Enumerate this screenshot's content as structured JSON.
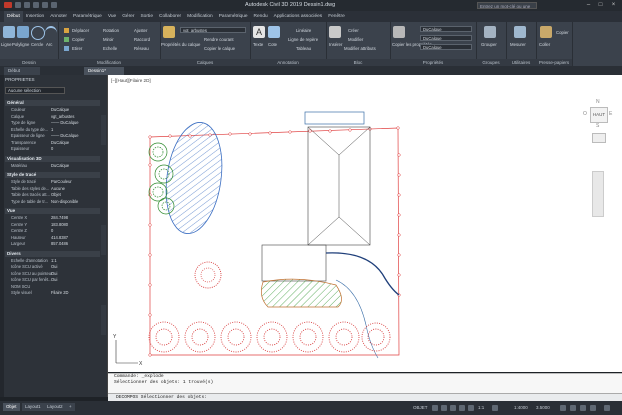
{
  "window": {
    "title": "Autodesk Civil 3D 2019   Dessin1.dwg",
    "search_placeholder": "Entrez un mot-clé ou une expression",
    "user": "Se connecter"
  },
  "menu_tabs": [
    "Début",
    "Insertion",
    "Annoter",
    "Paramétrique",
    "Vue",
    "Gérer",
    "Sortie",
    "Collaborer",
    "Modification",
    "Paramétrique",
    "Rendu",
    "Applications associées",
    "Fenêtre"
  ],
  "active_tab": 0,
  "ribbon": {
    "dessin": {
      "label": "Dessin",
      "items": [
        "Ligne",
        "Polyligne",
        "Cercle",
        "Arc"
      ]
    },
    "modification": {
      "label": "Modification",
      "items": [
        "Déplacer",
        "Rotation",
        "Ajuster",
        "Copier",
        "Miroir",
        "Raccord",
        "Etirer",
        "Echelle",
        "Réseau"
      ]
    },
    "calques": {
      "label": "Calques",
      "items": [
        "Propriétés du calque",
        "Rendre courant",
        "Copier le calque"
      ],
      "layer_value": "vgt_arbustes"
    },
    "annotation": {
      "label": "Annotation",
      "items": [
        "Texte",
        "Cote",
        "Linéaire",
        "Ligne de repère",
        "Tableau"
      ]
    },
    "bloc": {
      "label": "Bloc",
      "items": [
        "Insérer",
        "Créer",
        "Modifier",
        "Modifier attributs"
      ]
    },
    "proprietes": {
      "label": "Propriétés",
      "items": [
        "Copier les propriétés"
      ],
      "color": "DuCalque",
      "linetype": "DuCalque",
      "lineweight": "DuCalque"
    },
    "groupes": {
      "label": "Groupes",
      "items": [
        "Grouper"
      ]
    },
    "utilitaires": {
      "label": "Utilitaires",
      "items": [
        "Mesurer"
      ]
    },
    "presse_papiers": {
      "label": "Presse-papiers",
      "items": [
        "Coller",
        "Copier"
      ]
    }
  },
  "file_tabs": [
    "Début",
    "Dessin1*"
  ],
  "properties": {
    "header": "PROPRIETES",
    "selection": "Aucune sélection",
    "sections": [
      {
        "title": "Général",
        "rows": [
          {
            "k": "Couleur",
            "v": "DuCalque"
          },
          {
            "k": "Calque",
            "v": "vgt_arbustes"
          },
          {
            "k": "Type de ligne",
            "v": "—— DuCalque"
          },
          {
            "k": "Echelle du type de...",
            "v": "1"
          },
          {
            "k": "Epaisseur de ligne",
            "v": "—— DuCalque"
          },
          {
            "k": "Transparence",
            "v": "DuCalque"
          },
          {
            "k": "Epaisseur",
            "v": "0"
          }
        ]
      },
      {
        "title": "Visualisation 3D",
        "rows": [
          {
            "k": "Matériau",
            "v": "DuCalque"
          }
        ]
      },
      {
        "title": "Style de tracé",
        "rows": [
          {
            "k": "Style de tracé",
            "v": "ParCouleur"
          },
          {
            "k": "Table des styles de...",
            "v": "Aucune"
          },
          {
            "k": "Table des tracés att...",
            "v": "Objet"
          },
          {
            "k": "Type de table de tr...",
            "v": "Non-disponible"
          }
        ]
      },
      {
        "title": "Vue",
        "rows": [
          {
            "k": "Centre X",
            "v": "284.7498"
          },
          {
            "k": "Centre Y",
            "v": "183.8080"
          },
          {
            "k": "Centre Z",
            "v": "0"
          },
          {
            "k": "Hauteur",
            "v": "414.8387"
          },
          {
            "k": "Largeur",
            "v": "857.0486"
          }
        ]
      },
      {
        "title": "Divers",
        "rows": [
          {
            "k": "Echelle d'annotation",
            "v": "1:1"
          },
          {
            "k": "Icône SCU activé",
            "v": "Oui"
          },
          {
            "k": "Icône SCU au pointeur",
            "v": "Oui"
          },
          {
            "k": "Icône SCU par fenêt...",
            "v": "Oui"
          },
          {
            "k": "NOM SCU",
            "v": ""
          },
          {
            "k": "Style visuel",
            "v": "Filaire 2D"
          }
        ]
      }
    ]
  },
  "viewport_label": "[−][Haut][Filaire 2D]",
  "viewcube": {
    "face": "HAUT",
    "n": "N",
    "s": "S",
    "e": "E",
    "o": "O"
  },
  "command": {
    "history": [
      "Commande: _explode",
      "Sélectionner des objets: 1 trouvé(s)"
    ],
    "prompt": "DECOMPOS Sélectionner des objets:"
  },
  "layout_tabs": [
    "Objet",
    "Layout1",
    "Layout2",
    "+"
  ],
  "status": {
    "model": "OBJET",
    "scale": "1:1",
    "coord": "1:4000",
    "tile": "3.5000"
  }
}
